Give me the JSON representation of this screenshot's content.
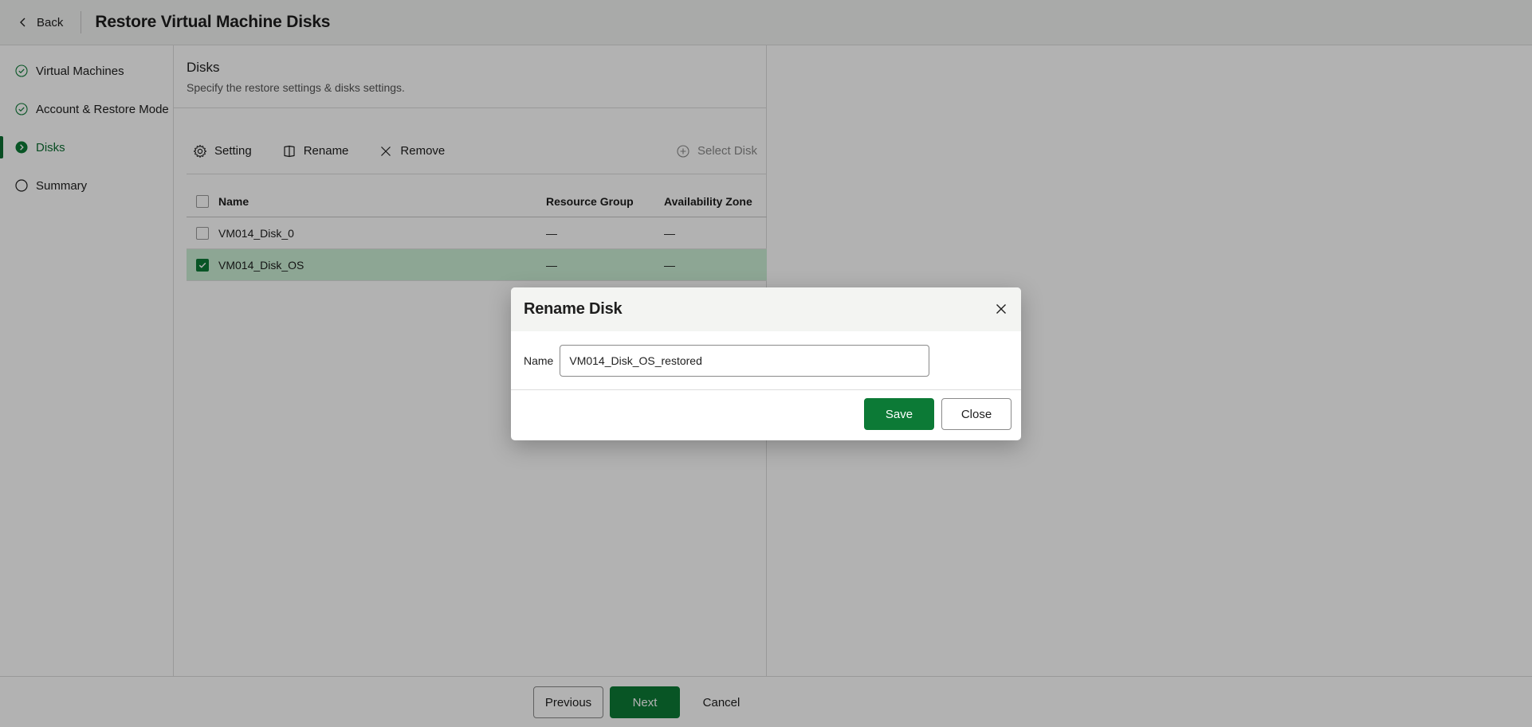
{
  "header": {
    "back_label": "Back",
    "title": "Restore Virtual Machine Disks"
  },
  "sidebar": {
    "steps": [
      {
        "label": "Virtual Machines",
        "state": "done"
      },
      {
        "label": "Account & Restore Mode",
        "state": "done"
      },
      {
        "label": "Disks",
        "state": "active"
      },
      {
        "label": "Summary",
        "state": "pending"
      }
    ]
  },
  "section": {
    "title": "Disks",
    "description": "Specify the restore settings & disks settings."
  },
  "toolbar": {
    "setting_label": "Setting",
    "rename_label": "Rename",
    "remove_label": "Remove",
    "select_disk_label": "Select Disk"
  },
  "table": {
    "columns": [
      "Name",
      "Resource Group",
      "Availability Zone"
    ],
    "rows": [
      {
        "name": "VM014_Disk_0",
        "resource_group": "—",
        "availability_zone": "—",
        "checked": false
      },
      {
        "name": "VM014_Disk_OS",
        "resource_group": "—",
        "availability_zone": "—",
        "checked": true
      }
    ]
  },
  "footer": {
    "previous_label": "Previous",
    "next_label": "Next",
    "cancel_label": "Cancel"
  },
  "dialog": {
    "title": "Rename Disk",
    "name_label": "Name",
    "name_value": "VM014_Disk_OS_restored",
    "save_label": "Save",
    "close_label": "Close"
  },
  "colors": {
    "accent": "#0c7a36",
    "selected_row": "#cbeed5"
  }
}
